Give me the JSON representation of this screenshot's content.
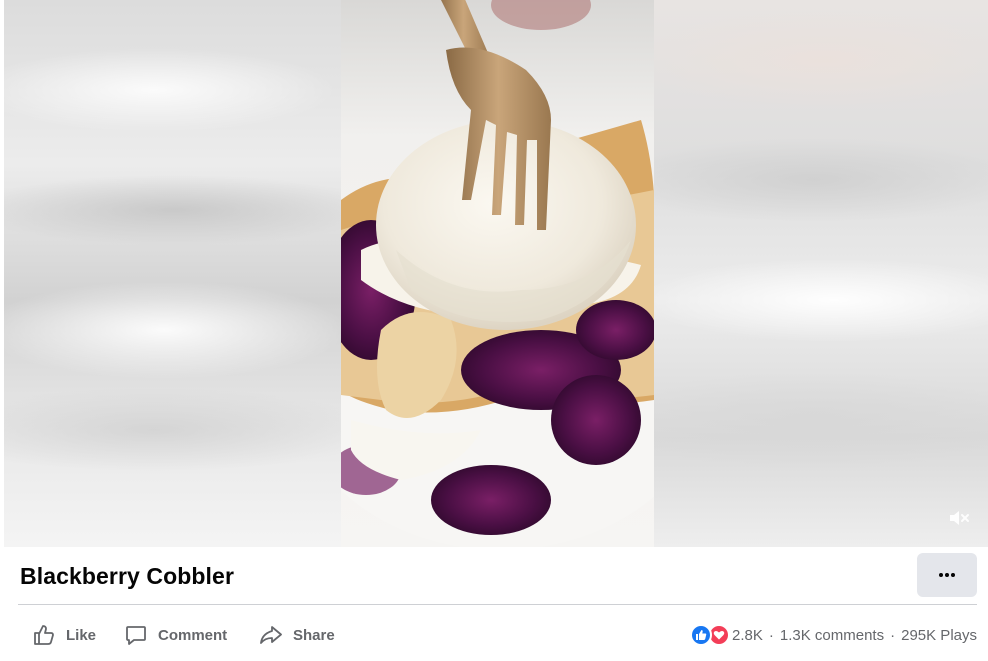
{
  "post": {
    "title": "Blackberry Cobbler"
  },
  "video": {
    "muted": true,
    "mute_icon": "speaker-muted-icon"
  },
  "actions": {
    "like_label": "Like",
    "comment_label": "Comment",
    "share_label": "Share"
  },
  "stats": {
    "reactions_count": "2.8K",
    "comments": "1.3K comments",
    "plays": "295K Plays",
    "separator": "·",
    "reaction_icons": [
      "like-reaction-icon",
      "love-reaction-icon"
    ]
  },
  "more_icon": "more-options-icon",
  "colors": {
    "text": "#050505",
    "secondary_text": "#65676b",
    "button_bg": "#e4e6eb",
    "like_blue": "#1877f2",
    "love_red": "#f33e58",
    "divider": "#ced0d4"
  }
}
